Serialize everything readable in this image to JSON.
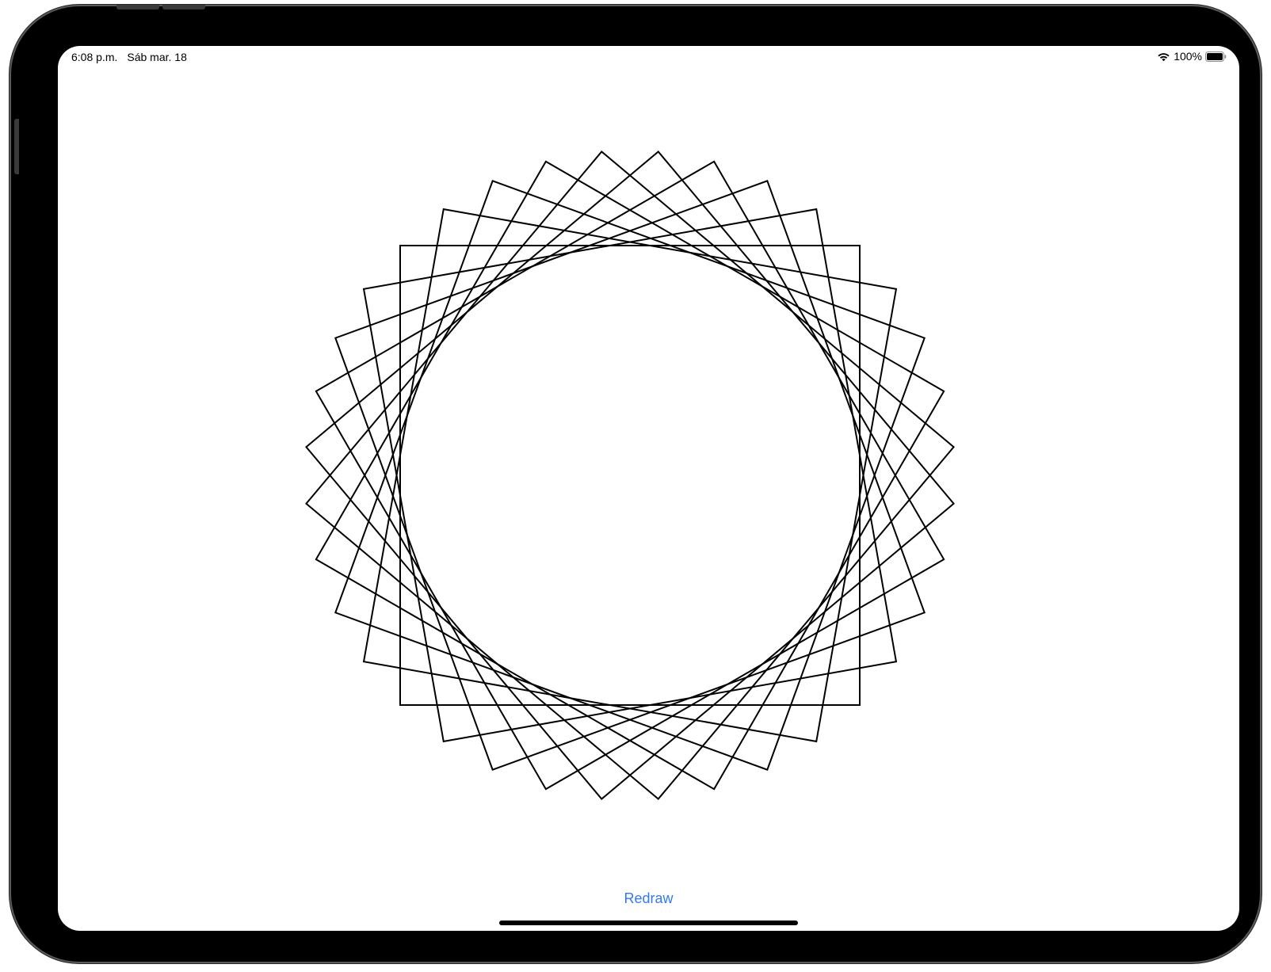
{
  "status_bar": {
    "time": "6:08 p.m.",
    "date": "Sáb mar. 18",
    "battery_percent": "100%",
    "wifi_icon": "wifi-icon",
    "battery_icon": "battery-full-icon",
    "battery_level": 1.0
  },
  "drawing": {
    "shape": "square",
    "square_count": 9,
    "rotation_step_degrees": 10,
    "stroke_color": "#000000"
  },
  "actions": {
    "redraw_label": "Redraw",
    "accent_color": "#3478f6"
  }
}
